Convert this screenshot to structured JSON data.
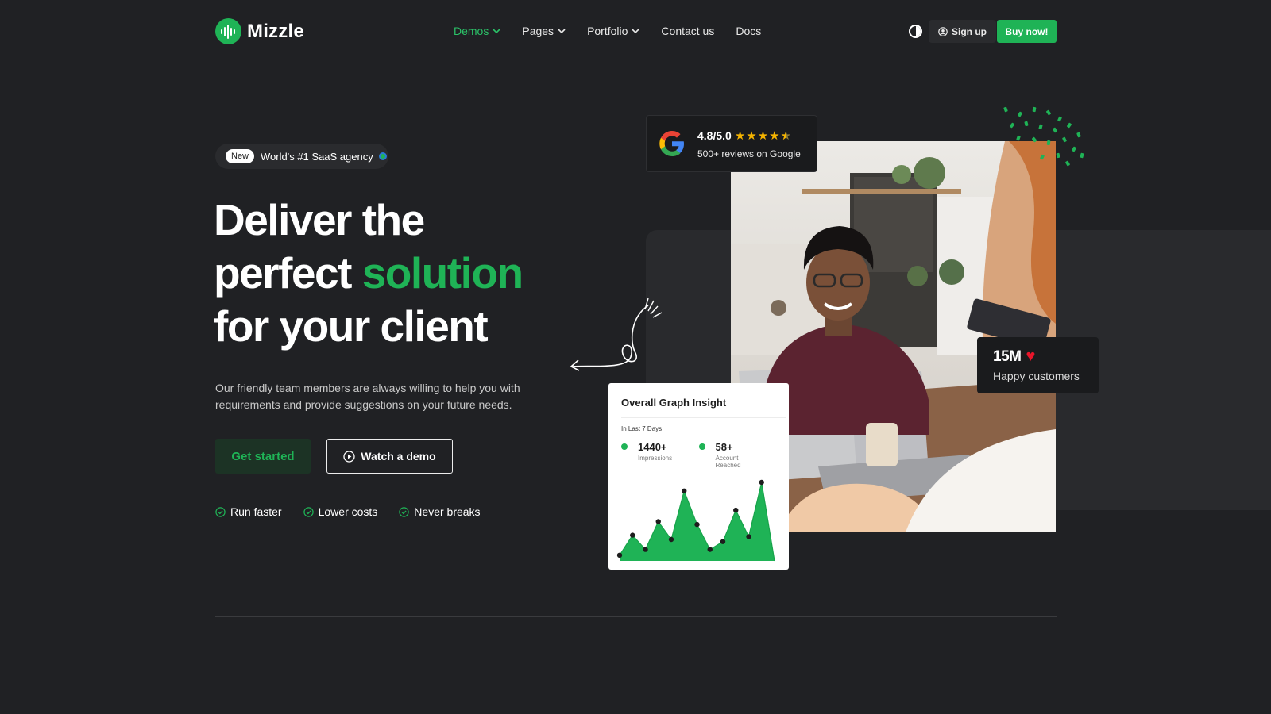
{
  "brand": {
    "name": "Mizzle",
    "accent": "#1fb356"
  },
  "nav": {
    "items": [
      {
        "label": "Demos",
        "has_dropdown": true,
        "active": true
      },
      {
        "label": "Pages",
        "has_dropdown": true
      },
      {
        "label": "Portfolio",
        "has_dropdown": true
      },
      {
        "label": "Contact us"
      },
      {
        "label": "Docs"
      }
    ],
    "signup_label": "Sign up",
    "buy_label": "Buy now!"
  },
  "hero": {
    "badge_new": "New",
    "badge_text": "World's #1 SaaS agency",
    "headline_line1": "Deliver the",
    "headline_line2_pre": "perfect ",
    "headline_line2_accent": "solution",
    "headline_line3": "for your client",
    "subtext": "Our friendly team members are always willing to help you with requirements and provide suggestions on your future needs.",
    "cta_primary": "Get started",
    "cta_secondary": "Watch a demo",
    "features": [
      "Run faster",
      "Lower costs",
      "Never breaks"
    ]
  },
  "google_card": {
    "rating": "4.8/5.0",
    "stars": 4.5,
    "reviews": "500+ reviews on Google"
  },
  "customers_card": {
    "value": "15M",
    "label": "Happy customers"
  },
  "graph_card": {
    "title": "Overall Graph Insight",
    "period": "In Last 7 Days",
    "stats": [
      {
        "value": "1440+",
        "label": "Impressions"
      },
      {
        "value": "58+",
        "label": "Account Reached"
      }
    ]
  },
  "chart_data": {
    "type": "area",
    "title": "Overall Graph Insight",
    "x": [
      0,
      1,
      2,
      3,
      4,
      5,
      6,
      7,
      8,
      9,
      10,
      11,
      12
    ],
    "values": [
      8,
      36,
      16,
      55,
      30,
      98,
      51,
      16,
      27,
      71,
      34,
      110,
      0
    ],
    "point_markers": true,
    "ylim": [
      0,
      110
    ],
    "grid": false,
    "color": "#1fb356"
  }
}
